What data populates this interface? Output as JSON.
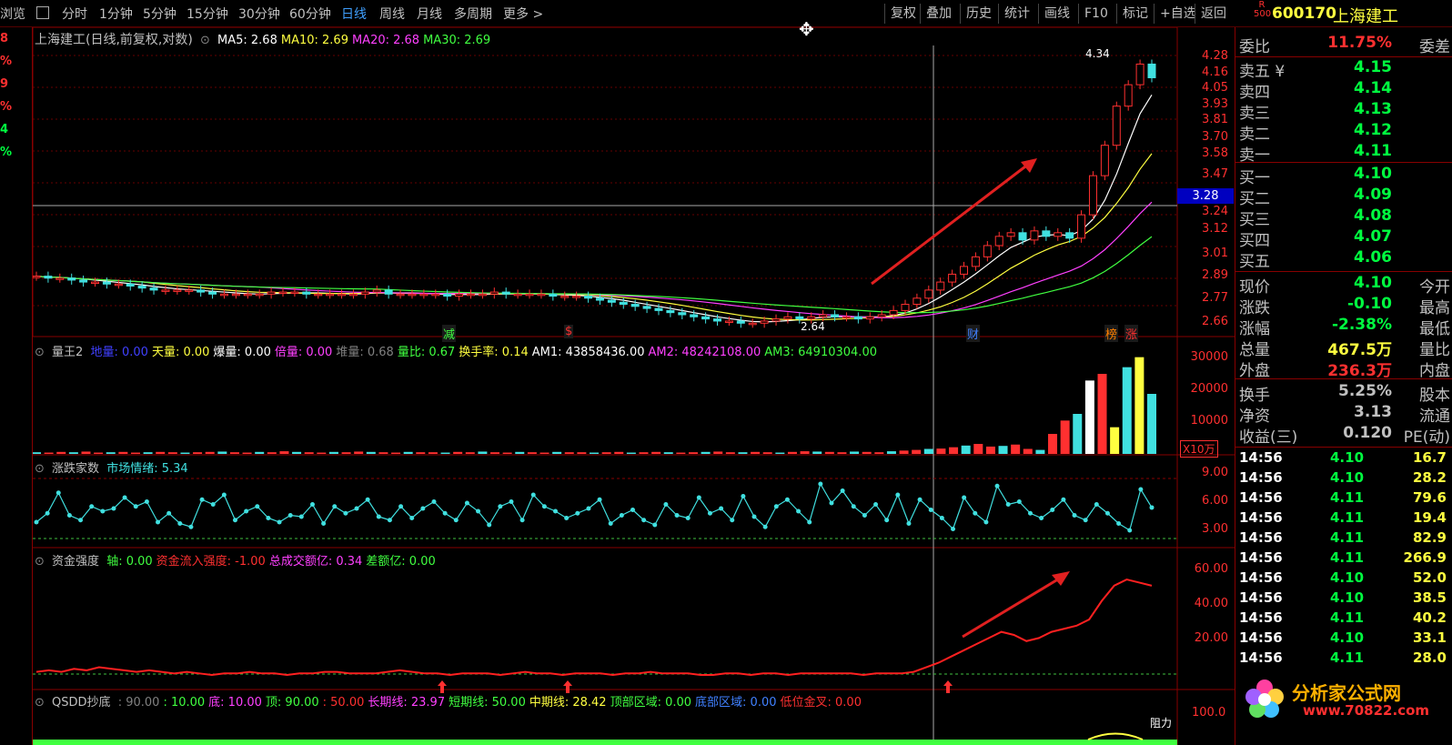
{
  "toolbar": {
    "left_cut": "浏览",
    "periods": [
      "分时",
      "1分钟",
      "5分钟",
      "15分钟",
      "30分钟",
      "60分钟",
      "日线",
      "周线",
      "月线",
      "多周期",
      "更多"
    ],
    "active_period": "日线",
    "right_buttons": [
      "复权",
      "叠加",
      "历史",
      "统计",
      "画线",
      "F10",
      "标记",
      "+自选",
      "返回"
    ],
    "stock_code": "600170",
    "stock_name": "上海建工",
    "badge": "R 500"
  },
  "left_strip": {
    "values": [
      "8",
      "%",
      "9",
      "%",
      "4",
      "%"
    ],
    "colors": [
      "#ff3030",
      "#ff3030",
      "#ff3030",
      "#ff3030",
      "#00ff40",
      "#00ff40"
    ]
  },
  "main_chart": {
    "title": "上海建工(日线,前复权,对数)",
    "ma": [
      {
        "label": "MA5: 2.68",
        "color": "#ffffff"
      },
      {
        "label": "MA10: 2.69",
        "color": "#ffff40"
      },
      {
        "label": "MA20: 2.68",
        "color": "#ff40ff"
      },
      {
        "label": "MA30: 2.69",
        "color": "#40ff40"
      }
    ],
    "y_labels": [
      "4.28",
      "4.16",
      "4.05",
      "3.93",
      "3.81",
      "3.70",
      "3.58",
      "3.47",
      "3.28",
      "3.24",
      "3.12",
      "3.01",
      "2.89",
      "2.77",
      "2.66"
    ],
    "crosshair_price": "3.28",
    "high_annot": "4.34",
    "low_annot": "2.64",
    "markers": [
      {
        "text": "减",
        "color": "#40ff40"
      },
      {
        "text": "$",
        "color": "#ff3030"
      },
      {
        "text": "财",
        "color": "#4080ff"
      },
      {
        "text": "榜",
        "color": "#ff8000"
      },
      {
        "text": "涨",
        "color": "#ff3030"
      }
    ]
  },
  "vol_panel": {
    "title": "量王2",
    "items": [
      {
        "label": "地量",
        "value": "0.00",
        "color": "#4040ff"
      },
      {
        "label": "天量",
        "value": "0.00",
        "color": "#ffff40"
      },
      {
        "label": "爆量",
        "value": "0.00",
        "color": "#ffffff"
      },
      {
        "label": "倍量",
        "value": "0.00",
        "color": "#ff40ff"
      },
      {
        "label": "堆量",
        "value": "0.68",
        "color": "#808080"
      },
      {
        "label": "量比",
        "value": "0.67",
        "color": "#40ff40"
      },
      {
        "label": "换手率",
        "value": "0.14",
        "color": "#ffff40"
      },
      {
        "label": "AM1",
        "value": "43858436.00",
        "color": "#ffffff"
      },
      {
        "label": "AM2",
        "value": "48242108.00",
        "color": "#ff40ff"
      },
      {
        "label": "AM3",
        "value": "64910304.00",
        "color": "#40ff40"
      }
    ],
    "y_labels": [
      "30000",
      "20000",
      "10000"
    ],
    "unit": "X10万"
  },
  "zd_panel": {
    "title": "涨跌家数",
    "items": [
      {
        "label": "市场情绪",
        "value": "5.34",
        "color": "#40e0e0"
      }
    ],
    "y_labels": [
      "9.00",
      "6.00",
      "3.00"
    ]
  },
  "fund_panel": {
    "title": "资金强度",
    "items": [
      {
        "label": "轴",
        "value": "0.00",
        "color": "#40ff40"
      },
      {
        "label": "资金流入强度",
        "value": "-1.00",
        "color": "#ff3030"
      },
      {
        "label": "总成交额亿",
        "value": "0.34",
        "color": "#ff40ff"
      },
      {
        "label": "差额亿",
        "value": "0.00",
        "color": "#40ff40"
      }
    ],
    "y_labels": [
      "60.00",
      "40.00",
      "20.00"
    ]
  },
  "qsdd_panel": {
    "title": "QSDD抄底",
    "items": [
      {
        "label": "",
        "value": "90.00",
        "color": "#808080"
      },
      {
        "label": "",
        "value": "10.00",
        "color": "#40ff40"
      },
      {
        "label": "底",
        "value": "10.00",
        "color": "#ff40ff"
      },
      {
        "label": "顶",
        "value": "90.00",
        "color": "#40ff40"
      },
      {
        "label": "",
        "value": "50.00",
        "color": "#ff3030"
      },
      {
        "label": "长期线",
        "value": "23.97",
        "color": "#ff40ff"
      },
      {
        "label": "短期线",
        "value": "50.00",
        "color": "#40ff40"
      },
      {
        "label": "中期线",
        "value": "28.42",
        "color": "#ffff40"
      },
      {
        "label": "顶部区域",
        "value": "0.00",
        "color": "#40ff40"
      },
      {
        "label": "底部区域",
        "value": "0.00",
        "color": "#4080ff"
      },
      {
        "label": "低位金叉",
        "value": "0.00",
        "color": "#ff3030"
      }
    ],
    "y_label": "100.0",
    "resist": "阻力"
  },
  "right_panel": {
    "weibi": {
      "label": "委比",
      "value": "11.75%",
      "right": "委差"
    },
    "sells": [
      {
        "label": "卖五",
        "price": "4.15",
        "mark": "¥"
      },
      {
        "label": "卖四",
        "price": "4.14",
        "mark": ""
      },
      {
        "label": "卖三",
        "price": "4.13",
        "mark": ""
      },
      {
        "label": "卖二",
        "price": "4.12",
        "mark": ""
      },
      {
        "label": "卖一",
        "price": "4.11",
        "mark": ""
      }
    ],
    "buys": [
      {
        "label": "买一",
        "price": "4.10"
      },
      {
        "label": "买二",
        "price": "4.09"
      },
      {
        "label": "买三",
        "price": "4.08"
      },
      {
        "label": "买四",
        "price": "4.07"
      },
      {
        "label": "买五",
        "price": "4.06"
      }
    ],
    "quotes": [
      {
        "label": "现价",
        "value": "4.10",
        "right": "今开",
        "color": "#00ff40"
      },
      {
        "label": "涨跌",
        "value": "-0.10",
        "right": "最高",
        "color": "#00ff40"
      },
      {
        "label": "涨幅",
        "value": "-2.38%",
        "right": "最低",
        "color": "#00ff40"
      },
      {
        "label": "总量",
        "value": "467.5万",
        "right": "量比",
        "color": "#ffff40"
      },
      {
        "label": "外盘",
        "value": "236.3万",
        "right": "内盘",
        "color": "#ff3030"
      },
      {
        "label": "换手",
        "value": "5.25%",
        "right": "股本",
        "color": "#c0c0c0"
      },
      {
        "label": "净资",
        "value": "3.13",
        "right": "流通",
        "color": "#c0c0c0"
      },
      {
        "label": "收益(三)",
        "value": "0.120",
        "right": "PE(动)",
        "color": "#c0c0c0"
      }
    ],
    "ticks": [
      {
        "time": "14:56",
        "price": "4.10",
        "vol": "16.7"
      },
      {
        "time": "14:56",
        "price": "4.10",
        "vol": "28.2"
      },
      {
        "time": "14:56",
        "price": "4.11",
        "vol": "79.6"
      },
      {
        "time": "14:56",
        "price": "4.11",
        "vol": "19.4"
      },
      {
        "time": "14:56",
        "price": "4.11",
        "vol": "82.9"
      },
      {
        "time": "14:56",
        "price": "4.11",
        "vol": "266.9"
      },
      {
        "time": "14:56",
        "price": "4.10",
        "vol": "52.0"
      },
      {
        "time": "14:56",
        "price": "4.10",
        "vol": "38.5"
      },
      {
        "time": "14:56",
        "price": "4.11",
        "vol": "40.2"
      },
      {
        "time": "14:56",
        "price": "4.10",
        "vol": "33.1"
      },
      {
        "time": "14:56",
        "price": "4.11",
        "vol": "28.0"
      }
    ],
    "logo_text": "分析家公式网",
    "logo_url": "www.70822.com"
  },
  "watermark": "分析家公式网www.70822.Com",
  "chart_data": {
    "type": "line",
    "title": "",
    "series_close": [
      2.89,
      2.88,
      2.88,
      2.87,
      2.86,
      2.86,
      2.85,
      2.85,
      2.84,
      2.83,
      2.82,
      2.82,
      2.82,
      2.82,
      2.81,
      2.8,
      2.8,
      2.8,
      2.8,
      2.8,
      2.81,
      2.81,
      2.81,
      2.8,
      2.8,
      2.8,
      2.8,
      2.8,
      2.81,
      2.82,
      2.8,
      2.8,
      2.8,
      2.8,
      2.8,
      2.79,
      2.8,
      2.8,
      2.8,
      2.81,
      2.8,
      2.8,
      2.8,
      2.8,
      2.79,
      2.79,
      2.79,
      2.78,
      2.77,
      2.76,
      2.75,
      2.74,
      2.73,
      2.72,
      2.71,
      2.7,
      2.69,
      2.68,
      2.67,
      2.67,
      2.66,
      2.66,
      2.67,
      2.68,
      2.69,
      2.68,
      2.69,
      2.7,
      2.69,
      2.69,
      2.68,
      2.69,
      2.7,
      2.72,
      2.75,
      2.78,
      2.82,
      2.86,
      2.9,
      2.94,
      2.99,
      3.05,
      3.1,
      3.12,
      3.08,
      3.13,
      3.1,
      3.12,
      3.09,
      3.22,
      3.45,
      3.64,
      3.9,
      4.05,
      4.2,
      4.1
    ],
    "ylim": [
      2.64,
      4.34
    ],
    "emotion": [
      3.2,
      4.5,
      7.5,
      4.2,
      3.5,
      5.5,
      4.8,
      5.2,
      6.8,
      5.5,
      6.2,
      3.2,
      4.5,
      3.0,
      2.5,
      6.5,
      5.8,
      7.2,
      3.5,
      4.8,
      5.5,
      3.8,
      3.2,
      4.2,
      4.0,
      5.8,
      3.0,
      5.5,
      4.5,
      5.2,
      6.5,
      4.0,
      3.5,
      5.5,
      3.8,
      5.2,
      6.2,
      4.5,
      3.5,
      6.0,
      4.8,
      2.8,
      5.5,
      6.2,
      3.5,
      7.2,
      5.5,
      4.8,
      3.8,
      4.5,
      5.2,
      6.5,
      3.0,
      4.2,
      5.0,
      3.5,
      2.8,
      5.8,
      4.2,
      3.8,
      6.8,
      4.5,
      5.2,
      3.5,
      7.0,
      4.0,
      2.5,
      5.5,
      6.5,
      4.8,
      3.2,
      8.8,
      6.0,
      7.8,
      5.5,
      4.2,
      5.8,
      3.5,
      7.2,
      3.0,
      6.5,
      5.0,
      3.8,
      2.2,
      6.8,
      4.5,
      3.2,
      8.5,
      5.8,
      6.2,
      4.5,
      3.8,
      5.0,
      6.5,
      4.2,
      3.5,
      5.8,
      4.5,
      3.0,
      2.0,
      8.0,
      5.34
    ],
    "fund": [
      2,
      3,
      2,
      4,
      3,
      5,
      4,
      3,
      2,
      3,
      2,
      1,
      2,
      1,
      0,
      1,
      1,
      2,
      1,
      1,
      0,
      1,
      1,
      2,
      2,
      1,
      1,
      1,
      2,
      3,
      2,
      1,
      1,
      0,
      1,
      1,
      1,
      0,
      1,
      2,
      1,
      1,
      0,
      1,
      1,
      1,
      0,
      1,
      1,
      2,
      1,
      1,
      1,
      0,
      0,
      1,
      1,
      0,
      1,
      1,
      0,
      1,
      1,
      1,
      1,
      1,
      0,
      1,
      1,
      1,
      2,
      5,
      8,
      12,
      16,
      20,
      24,
      28,
      26,
      22,
      24,
      28,
      30,
      32,
      36,
      48,
      58,
      62,
      60,
      58
    ],
    "volume": [
      0.5,
      0.4,
      0.6,
      0.5,
      0.7,
      0.4,
      0.5,
      0.6,
      0.4,
      0.5,
      0.6,
      0.5,
      0.4,
      0.5,
      0.6,
      0.7,
      0.5,
      0.4,
      0.6,
      0.5,
      0.8,
      0.6,
      0.5,
      0.4,
      0.6,
      0.5,
      0.7,
      0.6,
      0.5,
      0.4,
      0.6,
      0.5,
      0.5,
      0.4,
      0.6,
      0.5,
      0.7,
      0.5,
      0.4,
      0.6,
      0.5,
      0.4,
      0.6,
      0.5,
      0.5,
      0.4,
      0.5,
      0.6,
      0.4,
      0.5,
      0.6,
      0.5,
      0.4,
      0.5,
      0.6,
      0.7,
      0.5,
      0.5,
      0.6,
      0.5,
      0.4,
      0.6,
      0.8,
      0.7,
      0.6,
      0.5,
      0.7,
      0.6,
      0.5,
      0.8,
      1.0,
      1.2,
      1.5,
      1.6,
      2.0,
      2.5,
      3.0,
      2.2,
      2.4,
      2.8,
      1.5,
      1.2,
      6.0,
      10.0,
      12.0,
      22.0,
      24.0,
      8.0,
      26.0,
      29.0,
      18.0
    ]
  }
}
